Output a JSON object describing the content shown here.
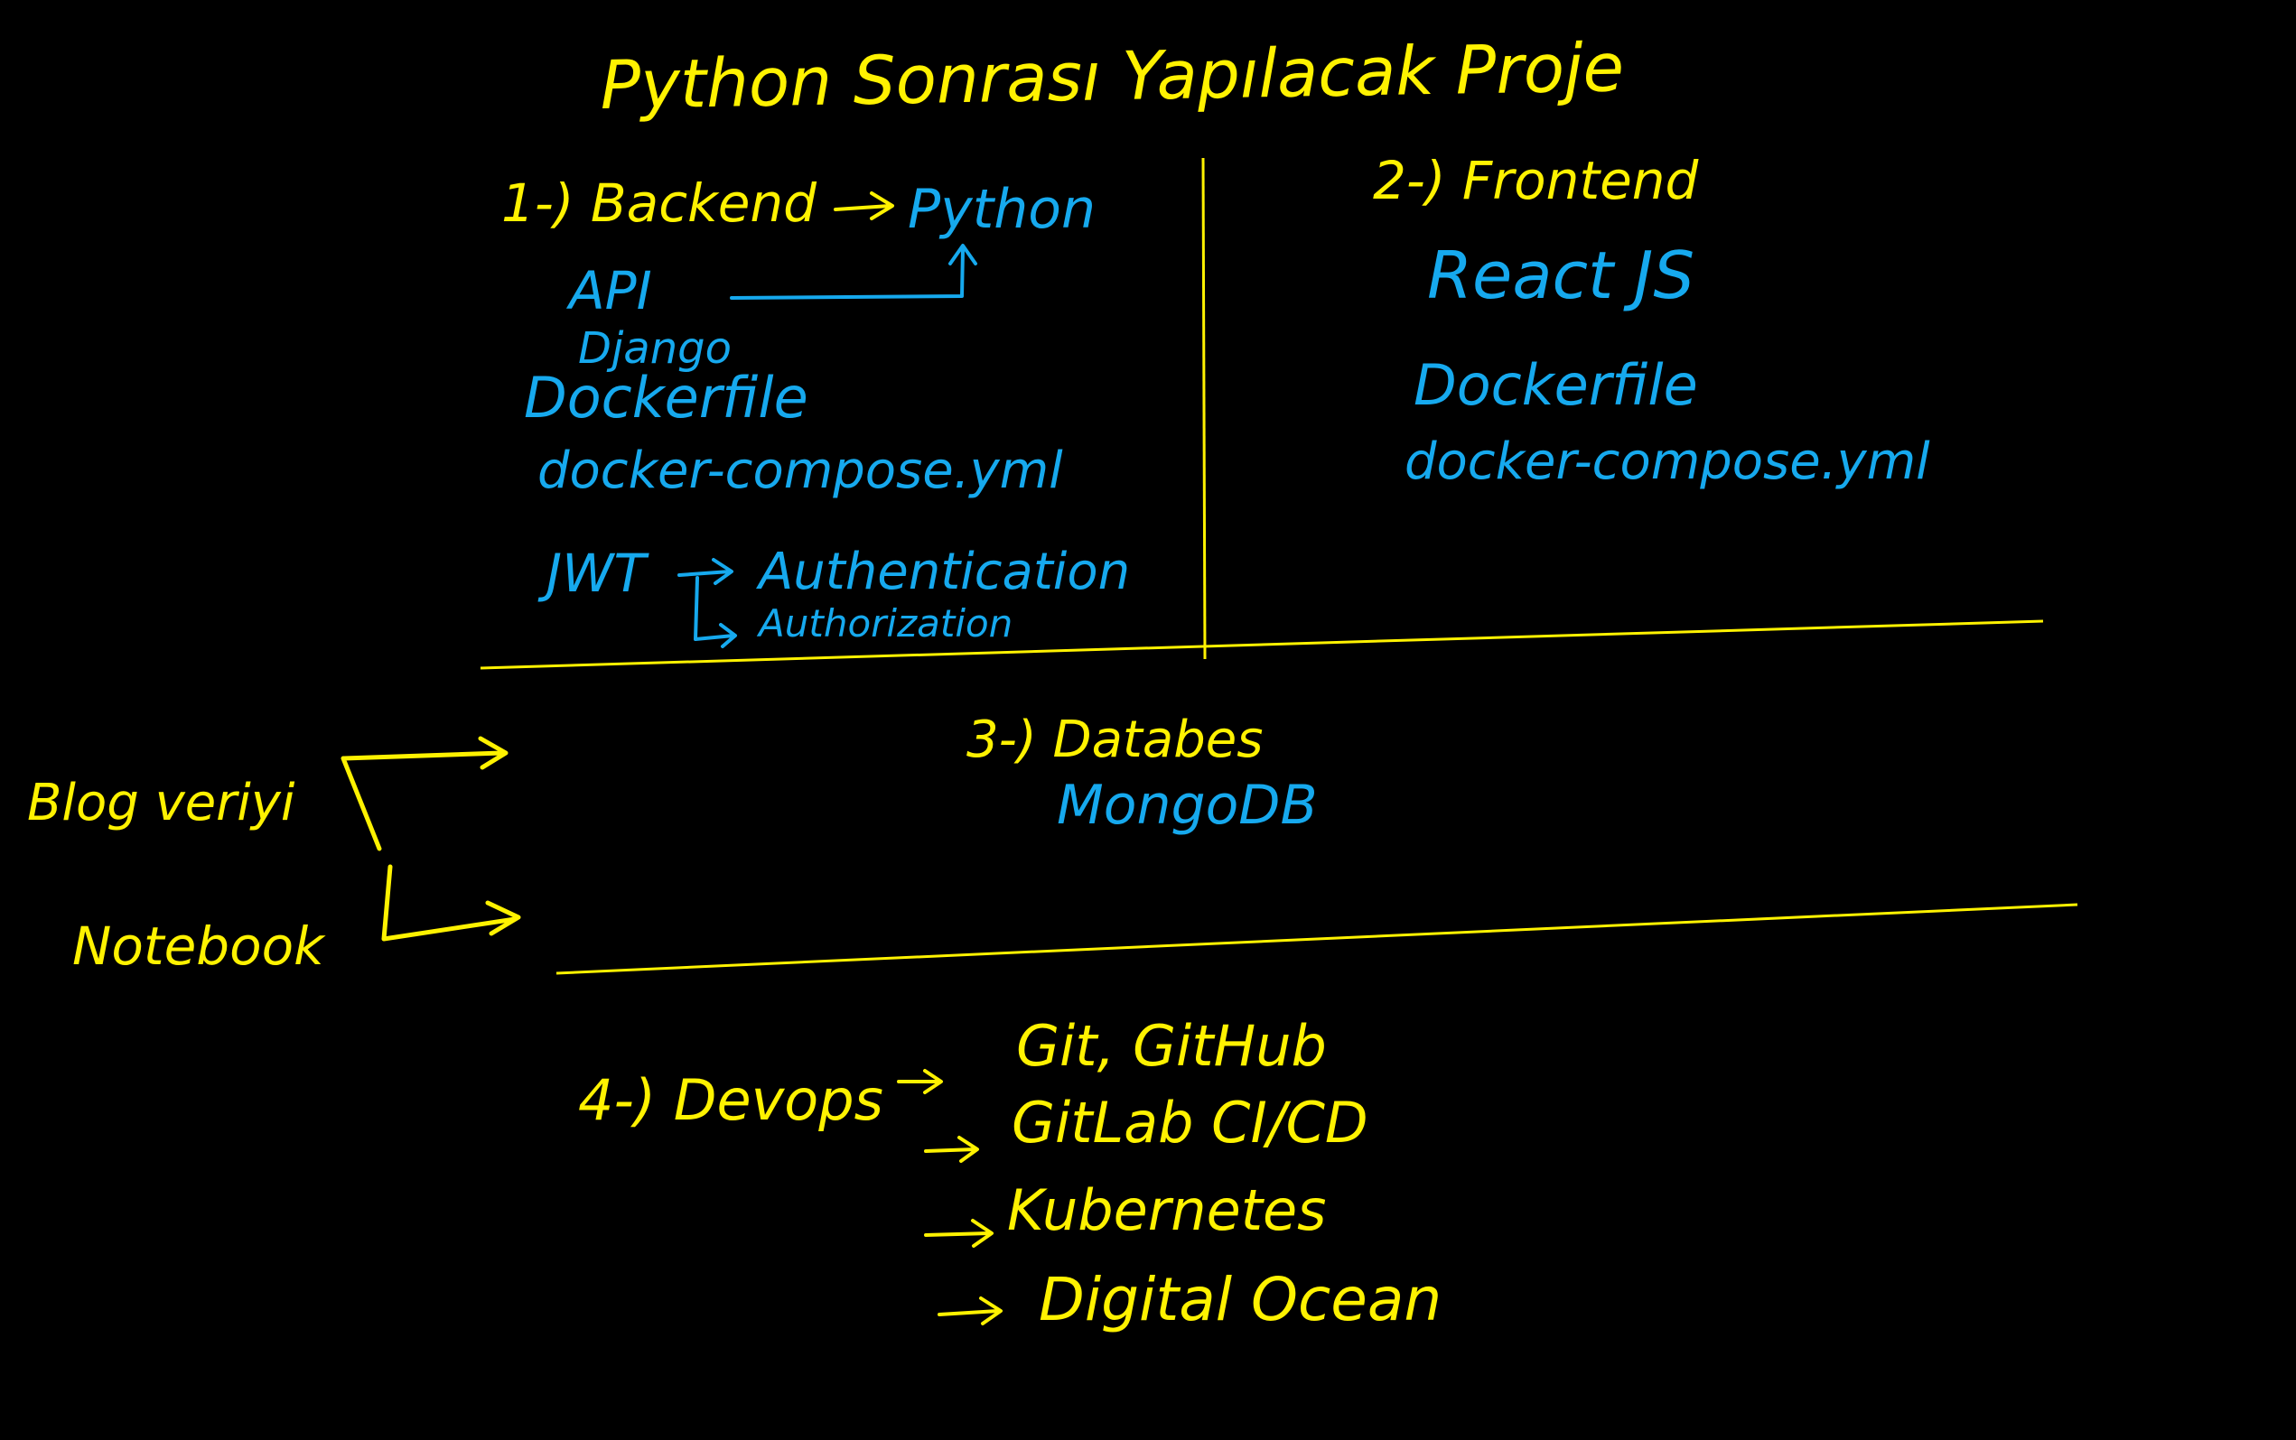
{
  "colors": {
    "background": "#000000",
    "yellow": "#fff200",
    "blue": "#16a9ee"
  },
  "title": "Python Sonrası Yapılacak Proje",
  "backend": {
    "heading": "1-) Backend",
    "language": "Python",
    "items": [
      "API",
      "Django",
      "Dockerfile",
      "docker-compose.yml",
      "JWT"
    ],
    "jwt_items": [
      "Authentication",
      "Authorization"
    ]
  },
  "frontend": {
    "heading": "2-) Frontend",
    "items": [
      "React JS",
      "Dockerfile",
      "docker-compose.yml"
    ]
  },
  "database": {
    "heading": "3-) Databes",
    "item": "MongoDB"
  },
  "devops": {
    "heading": "4-) Devops",
    "items": [
      "Git, GitHub",
      "GitLab CI/CD",
      "Kubernetes",
      "Digital Ocean"
    ]
  },
  "side": {
    "items": [
      "Blog veriyi",
      "Notebook"
    ]
  }
}
